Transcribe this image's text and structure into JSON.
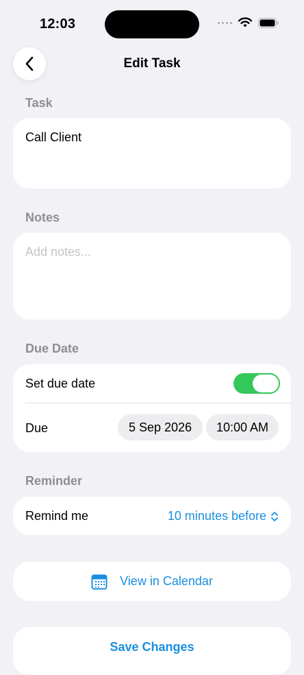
{
  "status_bar": {
    "time": "12:03"
  },
  "nav": {
    "title": "Edit Task",
    "back_icon": "chevron-left-icon"
  },
  "task": {
    "label": "Task",
    "value": "Call Client"
  },
  "notes": {
    "label": "Notes",
    "placeholder": "Add notes..."
  },
  "due_date": {
    "label": "Due Date",
    "toggle_label": "Set due date",
    "toggle_on": true,
    "due_label": "Due",
    "date": "5 Sep 2026",
    "time": "10:00 AM"
  },
  "reminder": {
    "label": "Reminder",
    "row_label": "Remind me",
    "value": "10 minutes before"
  },
  "actions": {
    "calendar_label": "View in Calendar",
    "save_label": "Save Changes"
  },
  "colors": {
    "accent": "#1a8fe0",
    "toggle_on": "#34c759",
    "background": "#f1f1f6"
  }
}
